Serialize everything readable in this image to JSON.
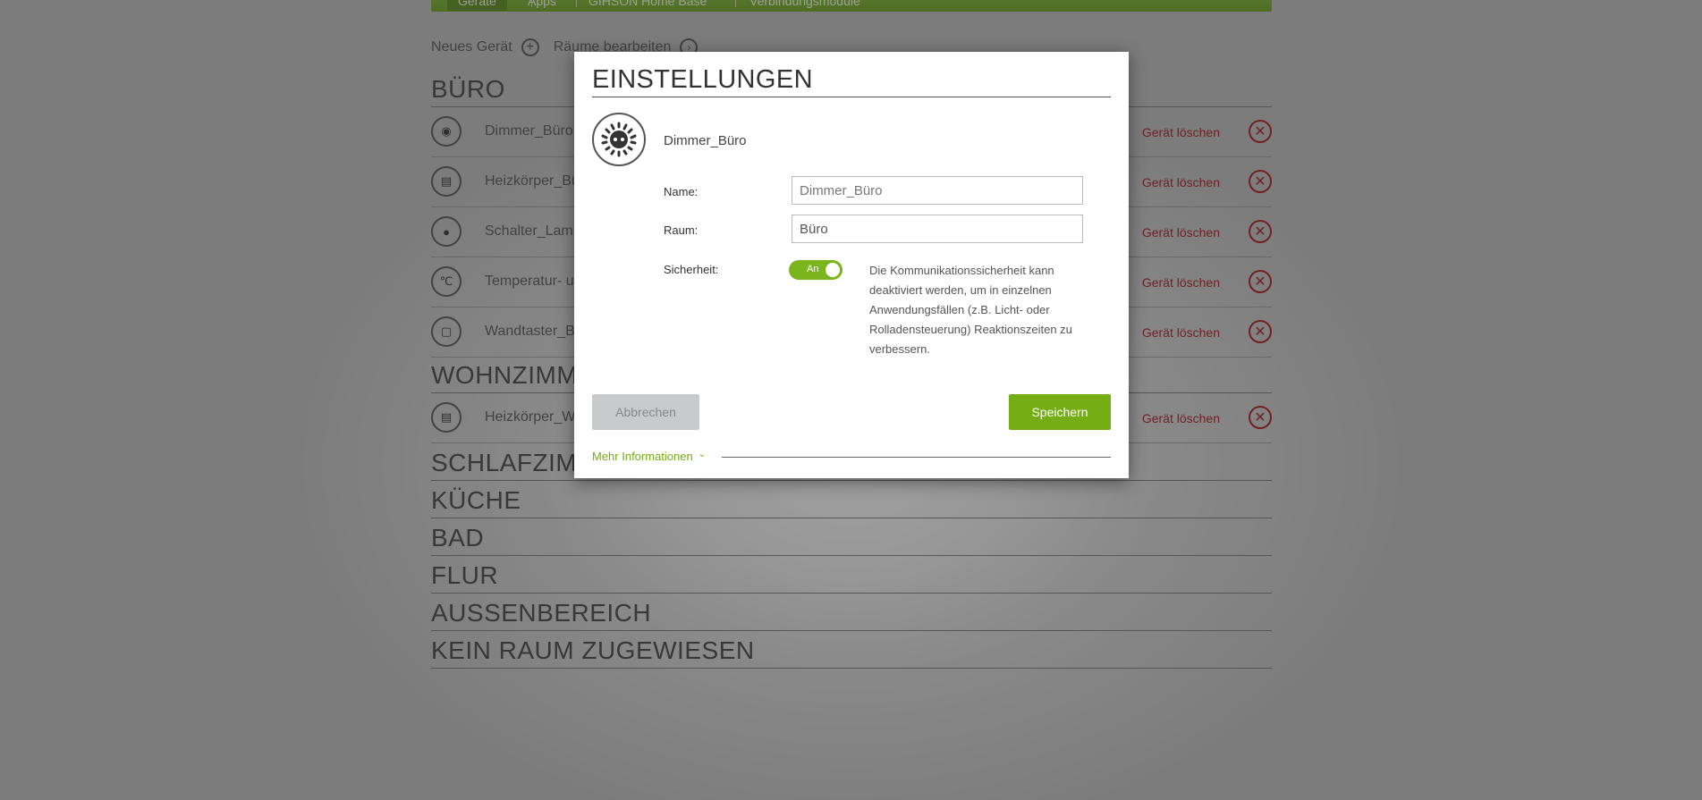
{
  "nav": {
    "items": [
      {
        "label": "Geräte"
      },
      {
        "label": "Apps"
      },
      {
        "label": "GIHSON Home Base"
      },
      {
        "label": "Verbindungsmodule"
      }
    ]
  },
  "toolbar": {
    "new_device_label": "Neues Gerät",
    "edit_rooms_label": "Räume bearbeiten"
  },
  "rooms": {
    "buero": {
      "title": "BÜRO",
      "devices": [
        {
          "name": "Dimmer_Büro",
          "delete_label": "Gerät löschen"
        },
        {
          "name": "Heizkörper_Bü",
          "delete_label": "Gerät löschen"
        },
        {
          "name": "Schalter_Lamp",
          "delete_label": "Gerät löschen"
        },
        {
          "name": "Temperatur- u",
          "delete_label": "Gerät löschen"
        },
        {
          "name": "Wandtaster_B",
          "delete_label": "Gerät löschen"
        }
      ]
    },
    "wohnzimmer": {
      "title": "WOHNZIMM",
      "devices": [
        {
          "name": "Heizkörper_W",
          "delete_label": "Gerät löschen"
        }
      ]
    },
    "schlafzimmer": {
      "title": "SCHLAFZIM"
    },
    "kueche": {
      "title": "KÜCHE"
    },
    "bad": {
      "title": "BAD"
    },
    "flur": {
      "title": "FLUR"
    },
    "aussenbereich": {
      "title": "AUSSENBEREICH"
    },
    "kein_raum": {
      "title": "KEIN RAUM ZUGEWIESEN"
    }
  },
  "modal": {
    "title": "EINSTELLUNGEN",
    "device_name": "Dimmer_Büro",
    "name_label": "Name:",
    "name_placeholder": "Dimmer_Büro",
    "room_label": "Raum:",
    "room_value": "Büro",
    "security_label": "Sicherheit:",
    "security_toggle": "An",
    "security_help": "Die Kommunikationssicherheit kann deaktiviert werden, um in einzelnen Anwendungsfällen (z.B. Licht- oder Rolladensteuerung) Reaktionszeiten zu verbessern.",
    "cancel_label": "Abbrechen",
    "save_label": "Speichern",
    "more_info_label": "Mehr Informationen"
  },
  "colors": {
    "accent": "#74ad14",
    "delete": "#a51d1d",
    "cancel_bg": "#c9cacc"
  },
  "icons": {
    "new_device": "plus-circle-icon",
    "edit_rooms": "chevron-right-circle-icon",
    "delete": "close-circle-icon",
    "more_info": "chevron-down-icon"
  }
}
